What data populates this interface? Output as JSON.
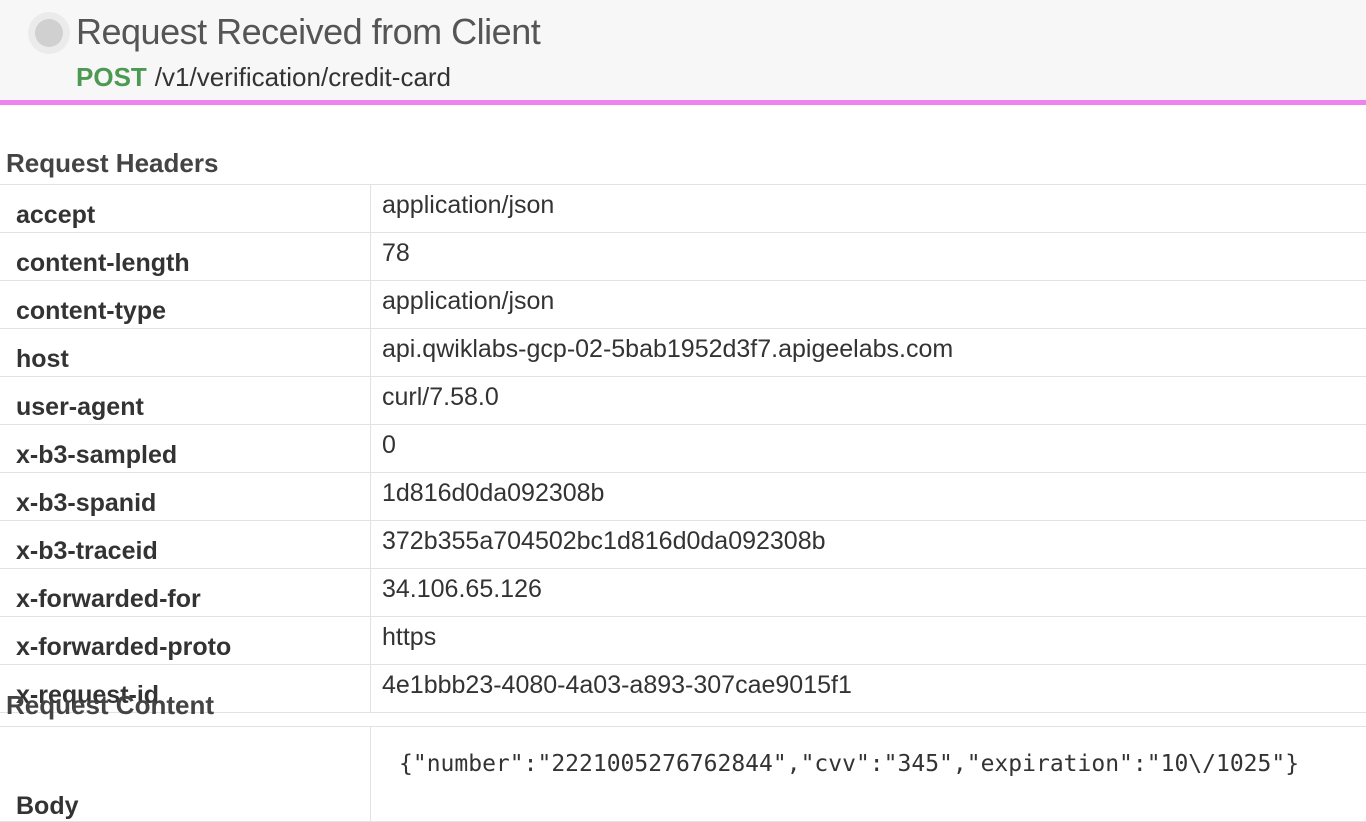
{
  "header": {
    "title": "Request Received from Client",
    "method": "POST",
    "path": "/v1/verification/credit-card"
  },
  "request_headers": {
    "title": "Request Headers",
    "rows": [
      {
        "key": "accept",
        "value": "application/json"
      },
      {
        "key": "content-length",
        "value": "78"
      },
      {
        "key": "content-type",
        "value": "application/json"
      },
      {
        "key": "host",
        "value": "api.qwiklabs-gcp-02-5bab1952d3f7.apigeelabs.com"
      },
      {
        "key": "user-agent",
        "value": "curl/7.58.0"
      },
      {
        "key": "x-b3-sampled",
        "value": "0"
      },
      {
        "key": "x-b3-spanid",
        "value": "1d816d0da092308b"
      },
      {
        "key": "x-b3-traceid",
        "value": "372b355a704502bc1d816d0da092308b"
      },
      {
        "key": "x-forwarded-for",
        "value": "34.106.65.126"
      },
      {
        "key": "x-forwarded-proto",
        "value": "https"
      },
      {
        "key": "x-request-id",
        "value": "4e1bbb23-4080-4a03-a893-307cae9015f1"
      }
    ]
  },
  "request_content": {
    "title": "Request Content",
    "body_label": "Body",
    "body_value": "{\"number\":\"2221005276762844\",\"cvv\":\"345\",\"expiration\":\"10\\/1025\"}"
  },
  "colors": {
    "accent_bar": "#ee82ee",
    "method": "#4c9a52"
  }
}
